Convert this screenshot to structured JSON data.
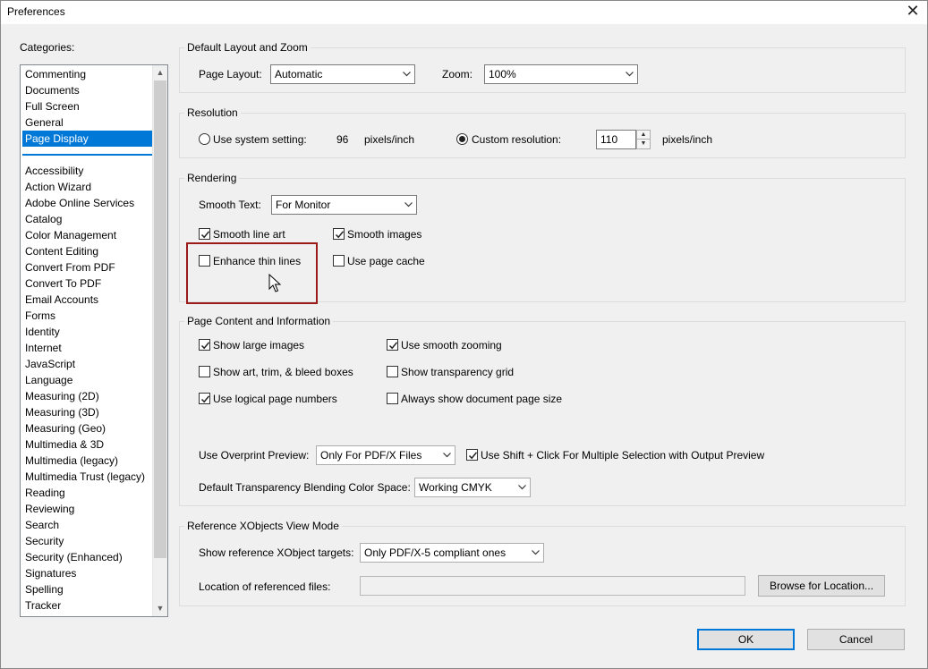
{
  "window": {
    "title": "Preferences"
  },
  "categories": {
    "label": "Categories:",
    "top_items": [
      "Commenting",
      "Documents",
      "Full Screen",
      "General",
      "Page Display"
    ],
    "bottom_items": [
      "Accessibility",
      "Action Wizard",
      "Adobe Online Services",
      "Catalog",
      "Color Management",
      "Content Editing",
      "Convert From PDF",
      "Convert To PDF",
      "Email Accounts",
      "Forms",
      "Identity",
      "Internet",
      "JavaScript",
      "Language",
      "Measuring (2D)",
      "Measuring (3D)",
      "Measuring (Geo)",
      "Multimedia & 3D",
      "Multimedia (legacy)",
      "Multimedia Trust (legacy)",
      "Reading",
      "Reviewing",
      "Search",
      "Security",
      "Security (Enhanced)",
      "Signatures",
      "Spelling",
      "Tracker"
    ],
    "selected": "Page Display"
  },
  "layout_zoom": {
    "title": "Default Layout and Zoom",
    "page_layout_label": "Page Layout:",
    "page_layout_value": "Automatic",
    "zoom_label": "Zoom:",
    "zoom_value": "100%"
  },
  "resolution": {
    "title": "Resolution",
    "system_label": "Use system setting:",
    "system_value": "96",
    "system_unit": "pixels/inch",
    "system_selected": false,
    "custom_label": "Custom resolution:",
    "custom_value": "110",
    "custom_unit": "pixels/inch",
    "custom_selected": true
  },
  "rendering": {
    "title": "Rendering",
    "smooth_text_label": "Smooth Text:",
    "smooth_text_value": "For Monitor",
    "smooth_line_art": {
      "label": "Smooth line art",
      "checked": true
    },
    "smooth_images": {
      "label": "Smooth images",
      "checked": true
    },
    "enhance_thin_lines": {
      "label": "Enhance thin lines",
      "checked": false
    },
    "use_page_cache": {
      "label": "Use page cache",
      "checked": false
    }
  },
  "page_content": {
    "title": "Page Content and Information",
    "show_large_images": {
      "label": "Show large images",
      "checked": true
    },
    "use_smooth_zooming": {
      "label": "Use smooth zooming",
      "checked": true
    },
    "show_art_trim_bleed": {
      "label": "Show art, trim, & bleed boxes",
      "checked": false
    },
    "show_transparency_grid": {
      "label": "Show transparency grid",
      "checked": false
    },
    "use_logical_page_numbers": {
      "label": "Use logical page numbers",
      "checked": true
    },
    "always_show_page_size": {
      "label": "Always show document page size",
      "checked": false
    },
    "overprint_label": "Use Overprint Preview:",
    "overprint_value": "Only For PDF/X Files",
    "shift_click": {
      "label": "Use Shift + Click For Multiple Selection with Output Preview",
      "checked": true
    },
    "blending_label": "Default Transparency Blending Color Space:",
    "blending_value": "Working CMYK"
  },
  "xobjects": {
    "title": "Reference XObjects View Mode",
    "targets_label": "Show reference XObject targets:",
    "targets_value": "Only PDF/X-5 compliant ones",
    "location_label": "Location of referenced files:",
    "location_value": "",
    "browse_label": "Browse for Location..."
  },
  "buttons": {
    "ok": "OK",
    "cancel": "Cancel"
  },
  "colors": {
    "selection": "#0078d7",
    "highlight_box": "#9b1b1b",
    "dialog_bg": "#f0f0f0"
  },
  "icons": {
    "close": "close-icon",
    "dropdown": "chevron-down-icon",
    "checkbox": "checkmark-icon",
    "cursor": "mouse-pointer-icon"
  }
}
